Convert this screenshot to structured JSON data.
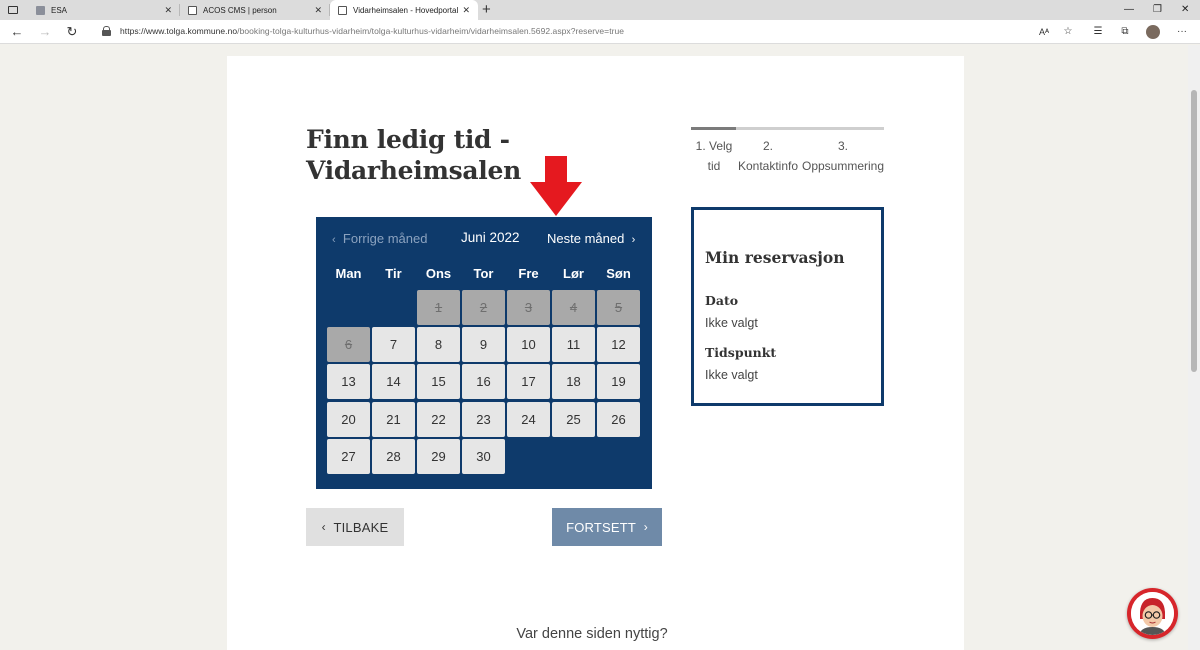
{
  "browser": {
    "tabs": [
      {
        "title": "ESA",
        "active": false
      },
      {
        "title": "ACOS CMS | person",
        "active": false
      },
      {
        "title": "Vidarheimsalen - Hovedportal",
        "active": true
      }
    ],
    "url_host": "https://www.tolga.kommune.no",
    "url_path": "/booking-tolga-kulturhus-vidarheim/tolga-kulturhus-vidarheim/vidarheimsalen.5692.aspx?reserve=true",
    "reader_icon_label": "Aᴬ"
  },
  "page": {
    "title": "Finn ledig tid - Vidarheimsalen",
    "steps": [
      {
        "label": "1. Velg tid",
        "state": "current"
      },
      {
        "label": "2. Kontaktinfo",
        "state": "upcoming"
      },
      {
        "label": "3. Oppsummering",
        "state": "upcoming"
      }
    ],
    "calendar": {
      "prev_label": "Forrige måned",
      "month_label": "Juni 2022",
      "next_label": "Neste måned",
      "weekdays": [
        "Man",
        "Tir",
        "Ons",
        "Tor",
        "Fre",
        "Lør",
        "Søn"
      ],
      "first_weekday_index": 2,
      "days_in_month": 30,
      "disabled_days": [
        1,
        2,
        3,
        4,
        5,
        6
      ]
    },
    "buttons": {
      "back": "TILBAKE",
      "next": "FORTSETT"
    },
    "reservation": {
      "title": "Min reservasjon",
      "date_label": "Dato",
      "date_value": "Ikke valgt",
      "time_label": "Tidspunkt",
      "time_value": "Ikke valgt"
    },
    "footer_question": "Var denne siden nyttig?"
  },
  "colors": {
    "calendar_bg": "#0e3a6b",
    "accent_red": "#e5191f",
    "next_button": "#6f8aa8"
  }
}
